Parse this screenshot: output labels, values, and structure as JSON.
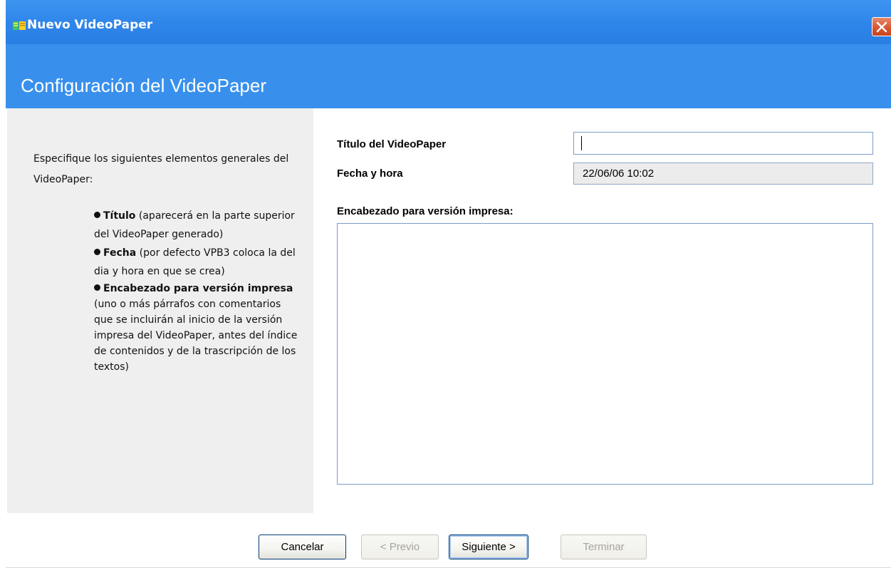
{
  "window": {
    "title": "Nuevo VideoPaper",
    "icons": {
      "app": "videopaper-app-icon",
      "close": "close-icon"
    },
    "colors": {
      "titlebar": "#2f86ea",
      "header": "#3890ec",
      "close": "#d9532f"
    }
  },
  "header": {
    "title": "Configuración del VideoPaper"
  },
  "instructions": {
    "intro": "Especifique los siguientes elementos generales del VideoPaper:",
    "items": [
      {
        "bold": "Título",
        "text": " (aparecerá en la parte superior del VideoPaper generado)"
      },
      {
        "bold": "Fecha",
        "text": " (por defecto VPB3 coloca la del dia y hora en que se crea)"
      },
      {
        "bold": "Encabezado para versión impresa",
        "text": " (uno o más párrafos con comentarios que se incluirán al inicio de la versión impresa del VideoPaper, antes del índice de contenidos y de la trascripción de los textos)"
      }
    ]
  },
  "form": {
    "title_label": "Título del VideoPaper",
    "title_value": "",
    "date_label": "Fecha y hora",
    "date_value": "22/06/06 10:02",
    "header_label": "Encabezado para versión impresa:",
    "header_value": ""
  },
  "buttons": {
    "cancel": "Cancelar",
    "previous": "< Previo",
    "next": "Siguiente >",
    "finish": "Terminar"
  }
}
